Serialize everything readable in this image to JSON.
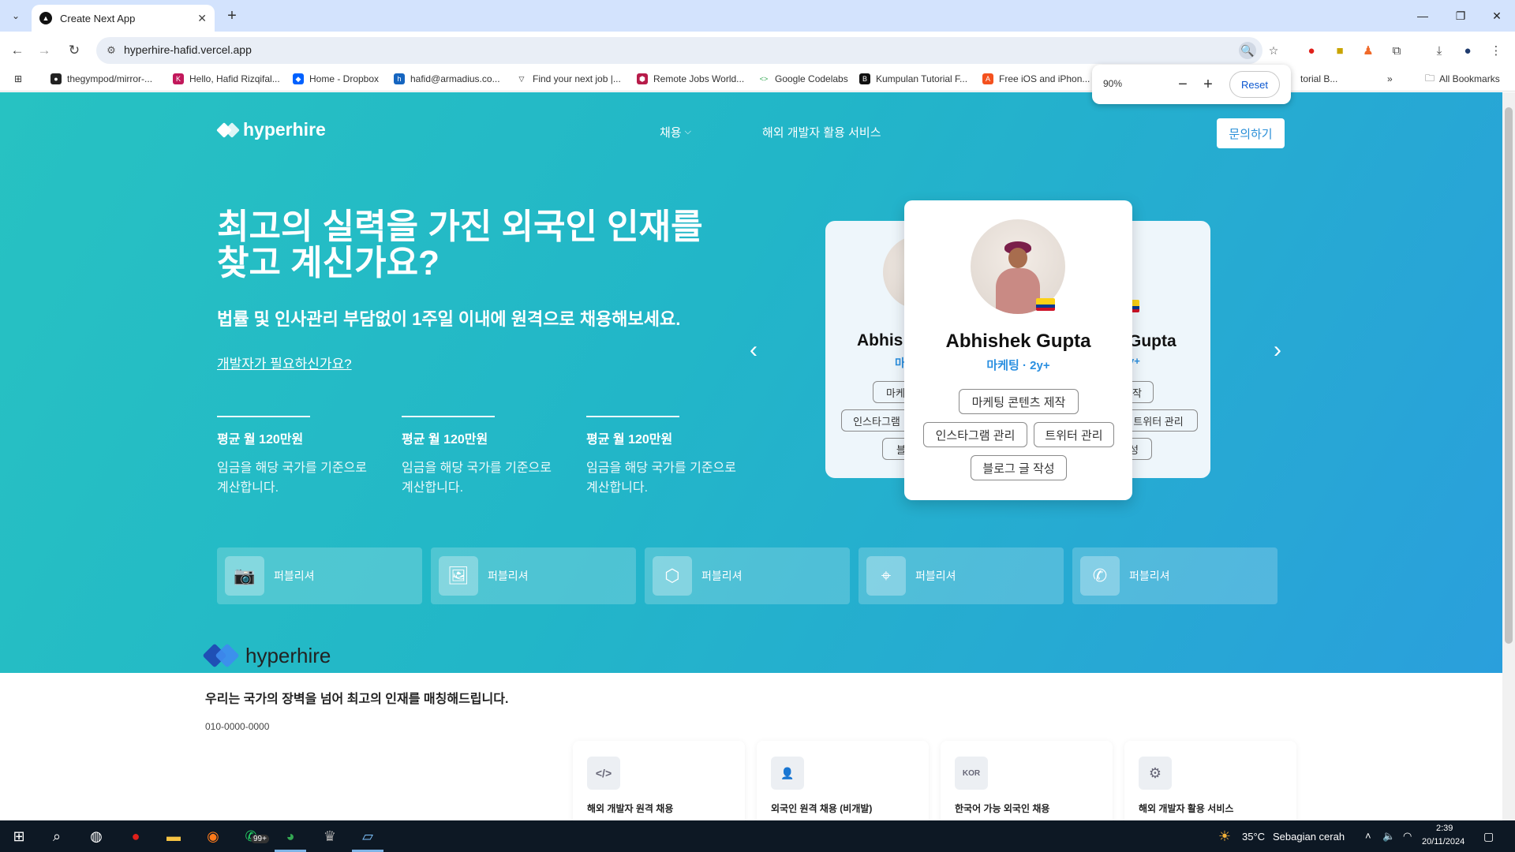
{
  "browser": {
    "tab_title": "Create Next App",
    "url": "hyperhire-hafid.vercel.app",
    "zoom": {
      "value": "90%",
      "reset_label": "Reset"
    },
    "bookmarks": [
      {
        "label": "thegympod/mirror-...",
        "color": "#222222"
      },
      {
        "label": "Hello, Hafid Rizqifal...",
        "color": "#c2185b"
      },
      {
        "label": "Home - Dropbox",
        "color": "#0061ff"
      },
      {
        "label": "hafid@armadius.co...",
        "color": "#1565c0"
      },
      {
        "label": "Find your next job |...",
        "color": "#333333"
      },
      {
        "label": "Remote Jobs World...",
        "color": "#b71c4a"
      },
      {
        "label": "Google Codelabs",
        "color": "#34a853"
      },
      {
        "label": "Kumpulan Tutorial F...",
        "color": "#111111"
      },
      {
        "label": "Free iOS and iPhon...",
        "color": "#f4511e"
      },
      {
        "label": "torial B...",
        "color": "#777777"
      }
    ],
    "all_bookmarks": "All Bookmarks"
  },
  "header": {
    "logo": "hyperhire",
    "nav": [
      {
        "label": "채용"
      },
      {
        "label": "해외 개발자 활용 서비스"
      }
    ],
    "contact_label": "문의하기"
  },
  "hero": {
    "headline_line1": "최고의 실력을 가진 외국인 인재를",
    "headline_line2": "찾고 계신가요?",
    "subhead": "법률 및 인사관리 부담없이 1주일 이내에 원격으로 채용해보세요.",
    "dev_link": "개발자가 필요하신가요?",
    "stats": [
      {
        "prefix": "평균 월 ",
        "bold": "120",
        "suffix": "만원",
        "desc": "임금을 해당 국가를 기준으로 계산합니다."
      },
      {
        "prefix": "평균 월 ",
        "bold": "120",
        "suffix": "만원",
        "desc": "임금을 해당 국가를 기준으로 계산합니다."
      },
      {
        "prefix": "평균 월 ",
        "bold": "120",
        "suffix": "만원",
        "desc": "임금을 해당 국가를 기준으로 계산합니다."
      }
    ]
  },
  "carousel": {
    "left": {
      "name": "Abhis",
      "role": "마",
      "chips": [
        "마케팅",
        "인스타그램",
        "블로"
      ]
    },
    "main": {
      "name": "Abhishek Gupta",
      "role": "마케팅 · 2y+",
      "chips": [
        "마케팅 콘텐츠 제작",
        "인스타그램 관리",
        "트위터 관리",
        "블로그 글 작성"
      ]
    },
    "right": {
      "name": "Gupta",
      "role": "y+",
      "chips": [
        "제작",
        "트위터 관리",
        "성"
      ]
    }
  },
  "categories": [
    {
      "label": "퍼블리셔",
      "icon": "📷"
    },
    {
      "label": "퍼블리셔",
      "icon": "🖼"
    },
    {
      "label": "퍼블리셔",
      "icon": "⬡"
    },
    {
      "label": "퍼블리셔",
      "icon": "⌖"
    },
    {
      "label": "퍼블리셔",
      "icon": "✆"
    }
  ],
  "footer": {
    "logo": "hyperhire",
    "tagline": "우리는 국가의 장벽을 넘어 최고의 인재를 매칭해드립니다.",
    "phone": "010-0000-0000",
    "services": [
      {
        "icon": "</>",
        "label": "해외 개발자 원격 채용"
      },
      {
        "icon": "👤",
        "label": "외국인 원격 채용 (비개발)"
      },
      {
        "icon": "KOR",
        "label": "한국어 가능 외국인 채용"
      },
      {
        "icon": "⚙",
        "label": "해외 개발자 활용 서비스"
      }
    ]
  },
  "taskbar": {
    "notif_badge": "99+",
    "temperature": "35°C",
    "weather": "Sebagian cerah",
    "time": "2:39",
    "date": "20/11/2024"
  },
  "colors": {
    "hero_start": "#27c2c2",
    "hero_end": "#2a9fdc",
    "accent_blue": "#2a8fe0",
    "logo_blue_dark": "#1f4fb5",
    "logo_blue_light": "#3f8cf0"
  }
}
